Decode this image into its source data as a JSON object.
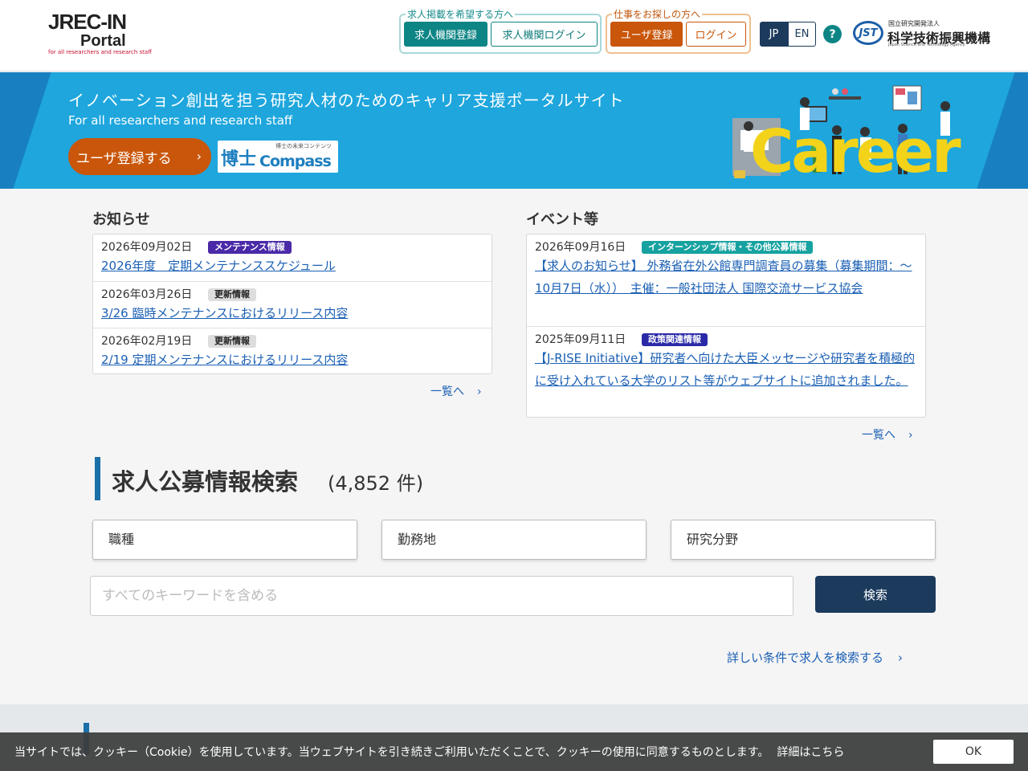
{
  "header": {
    "logo": {
      "line1": "JREC-IN",
      "line2": "Portal",
      "tagline": "for all researchers and research staff"
    },
    "employer_group": {
      "caption": "求人掲載を希望する方へ",
      "register_label": "求人機関登録",
      "login_label": "求人機関ログイン"
    },
    "jobseeker_group": {
      "caption": "仕事をお探しの方へ",
      "register_label": "ユーザ登録",
      "login_label": "ログイン"
    },
    "lang": {
      "jp": "JP",
      "en": "EN",
      "selected": "JP"
    },
    "help_label": "?",
    "jst": {
      "mark": "JST",
      "line1": "国立研究開発法人",
      "line2": "科学技術振興機構",
      "line3": "Japan Science and Technology Agency"
    }
  },
  "banner": {
    "title": "イノベーション創出を担う研究人材のためのキャリア支援ポータルサイト",
    "subtitle": "For all researchers and research staff",
    "register_button": "ユーザ登録する",
    "chevron": "›",
    "compass": {
      "kanji": "博士",
      "brand": "Compass",
      "tagline": "博士の未来コンテンツ"
    },
    "career_text": "Career"
  },
  "news": {
    "heading": "お知らせ",
    "items": [
      {
        "date": "2026年09月02日",
        "badge": "メンテナンス情報",
        "link": "2026年度　定期メンテナンススケジュール"
      },
      {
        "date": "2026年03月26日",
        "badge": "更新情報",
        "link": "3/26 臨時メンテナンスにおけるリリース内容"
      },
      {
        "date": "2026年02月19日",
        "badge": "更新情報",
        "link": "2/19 定期メンテナンスにおけるリリース内容"
      }
    ],
    "more": "一覧へ"
  },
  "events": {
    "heading": "イベント等",
    "items": [
      {
        "date": "2026年09月16日",
        "badge": "インターンシップ情報・その他公募情報",
        "link": "【求人のお知らせ】 外務省在外公館専門調査員の募集（募集期間：～10月7日（水））　主催：一般社団法人 国際交流サービス協会"
      },
      {
        "date": "2025年09月11日",
        "badge": "政策関連情報",
        "link": "【J-RISE Initiative】研究者へ向けた大臣メッセージや研究者を積極的に受け入れている大学のリスト等がウェブサイトに追加されました。"
      }
    ],
    "more": "一覧へ"
  },
  "search": {
    "title": "求人公募情報検索",
    "count": "(4,852 件)",
    "job_type": "職種",
    "location": "勤務地",
    "field": "研究分野",
    "keyword_placeholder": "すべてのキーワードを含める",
    "search_button": "検索",
    "advanced_link": "詳しい条件で求人を検索する"
  },
  "cookie": {
    "message": "当サイトでは、クッキー（Cookie）を使用しています。当ウェブサイトを引き続きご利用いただくことで、クッキーの使用に同意するものとします。",
    "details_link": "詳細はこちら",
    "ok_button": "OK"
  },
  "colors": {
    "teal": "#0e8585",
    "orange": "#c9560a",
    "navy": "#1b3a5c",
    "banner_blue": "#1ea6dd"
  }
}
